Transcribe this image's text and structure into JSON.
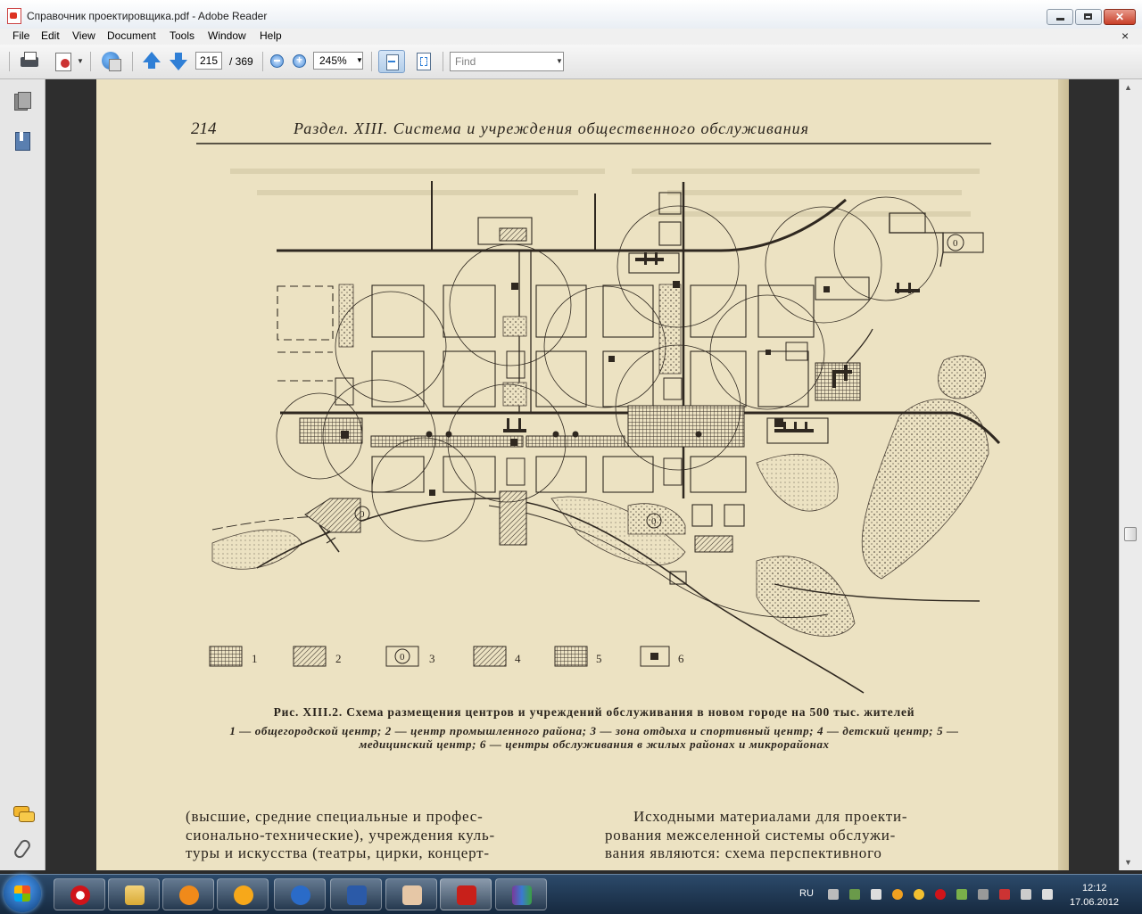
{
  "window": {
    "title": "Справочник проектировщика.pdf - Adobe Reader"
  },
  "menu": [
    "File",
    "Edit",
    "View",
    "Document",
    "Tools",
    "Window",
    "Help"
  ],
  "toolbar": {
    "current_page": "215",
    "total_pages": "/ 369",
    "zoom": "245%",
    "find_placeholder": "Find"
  },
  "document": {
    "page_number": "214",
    "header": "Раздел. XIII. Система и учреждения общественного обслуживания",
    "legend_numbers": [
      "1",
      "2",
      "3",
      "4",
      "5",
      "6"
    ],
    "caption_title": "Рис. XIII.2. Схема размещения центров и учреждений обслуживания в новом городе на 500 тыс. жителей",
    "caption_items": "1 — общегородской центр; 2 — центр промышленного района; 3 — зона отдыха и спортивный центр; 4 — детский центр; 5 — медицинский центр; 6 — центры обслуживания в жилых районах и микрорайонах",
    "left_column": [
      "(высшие, средние специальные и профес-",
      "сионально-технические), учреждения куль-",
      "туры и искусства (театры, цирки, концерт-"
    ],
    "right_column": [
      "Исходными материалами для проекти-",
      "рования межселенной системы обслужи-",
      "вания являются: схема перспективного"
    ]
  },
  "taskbar": {
    "language": "RU",
    "time": "12:12",
    "date": "17.06.2012"
  }
}
